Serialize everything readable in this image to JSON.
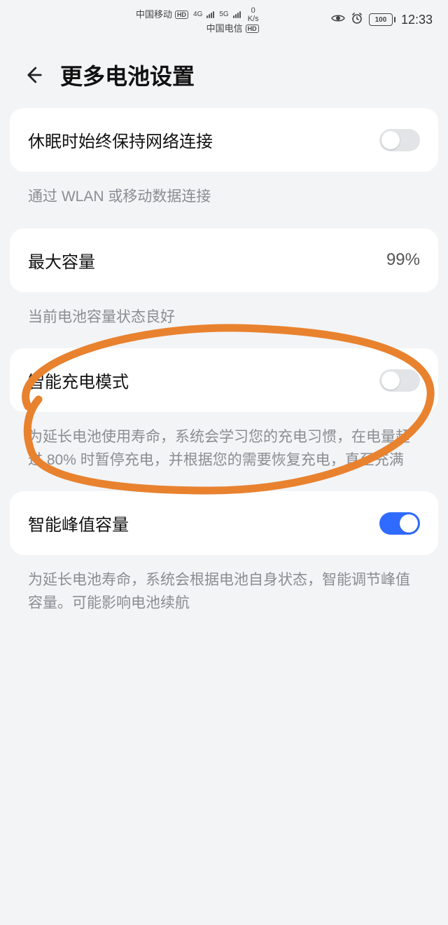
{
  "status": {
    "carrier1": "中国移动",
    "carrier2": "中国电信",
    "net1": "4G",
    "net2": "5G",
    "speed_top": "0",
    "speed_bottom": "K/s",
    "battery": "100",
    "time": "12:33"
  },
  "header": {
    "title": "更多电池设置"
  },
  "rows": {
    "sleepNet": {
      "label": "休眠时始终保持网络连接",
      "on": false,
      "desc": "通过 WLAN 或移动数据连接"
    },
    "capacity": {
      "label": "最大容量",
      "value": "99%",
      "desc": "当前电池容量状态良好"
    },
    "smartCharge": {
      "label": "智能充电模式",
      "on": false,
      "desc": "为延长电池使用寿命，系统会学习您的充电习惯，在电量超过 80% 时暂停充电，并根据您的需要恢复充电，直至充满"
    },
    "peak": {
      "label": "智能峰值容量",
      "on": true,
      "desc": "为延长电池寿命，系统会根据电池自身状态，智能调节峰值容量。可能影响电池续航"
    }
  }
}
